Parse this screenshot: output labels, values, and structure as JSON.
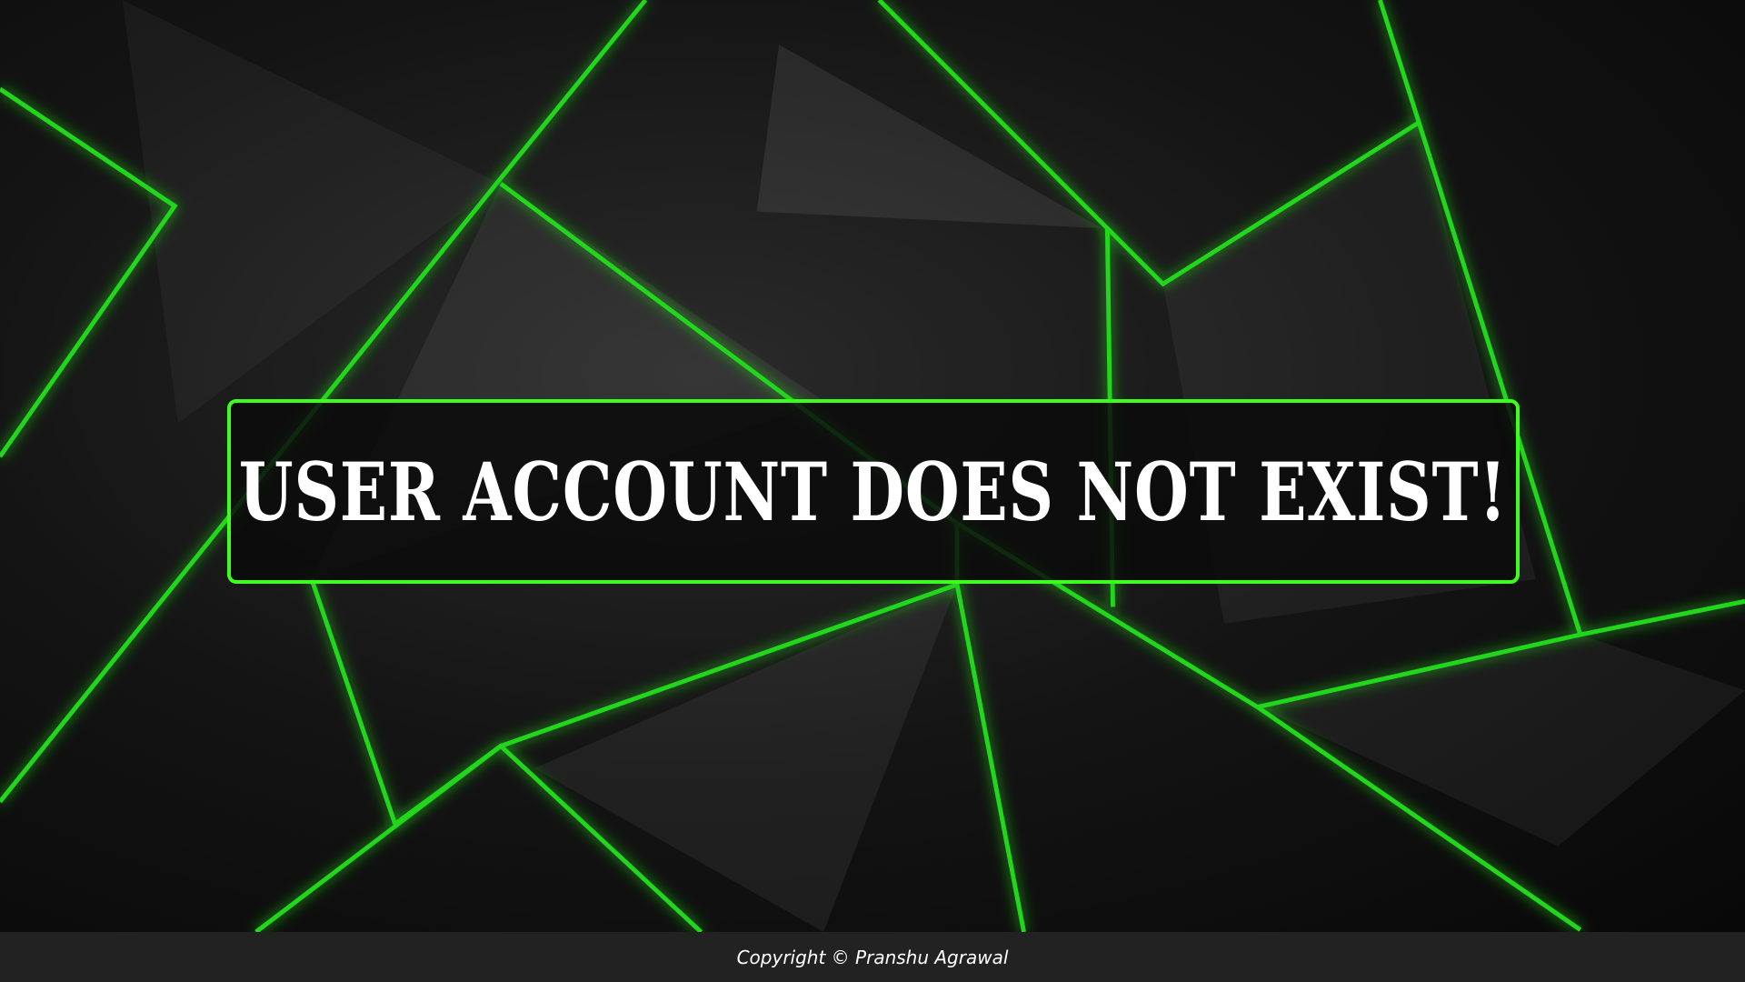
{
  "message": "USER ACCOUNT DOES NOT EXIST!",
  "footer": {
    "copyright": "Copyright © Pranshu Agrawal"
  },
  "colors": {
    "accent": "#3cff1e",
    "line": "#22d61a",
    "footer_bg": "#222222"
  }
}
